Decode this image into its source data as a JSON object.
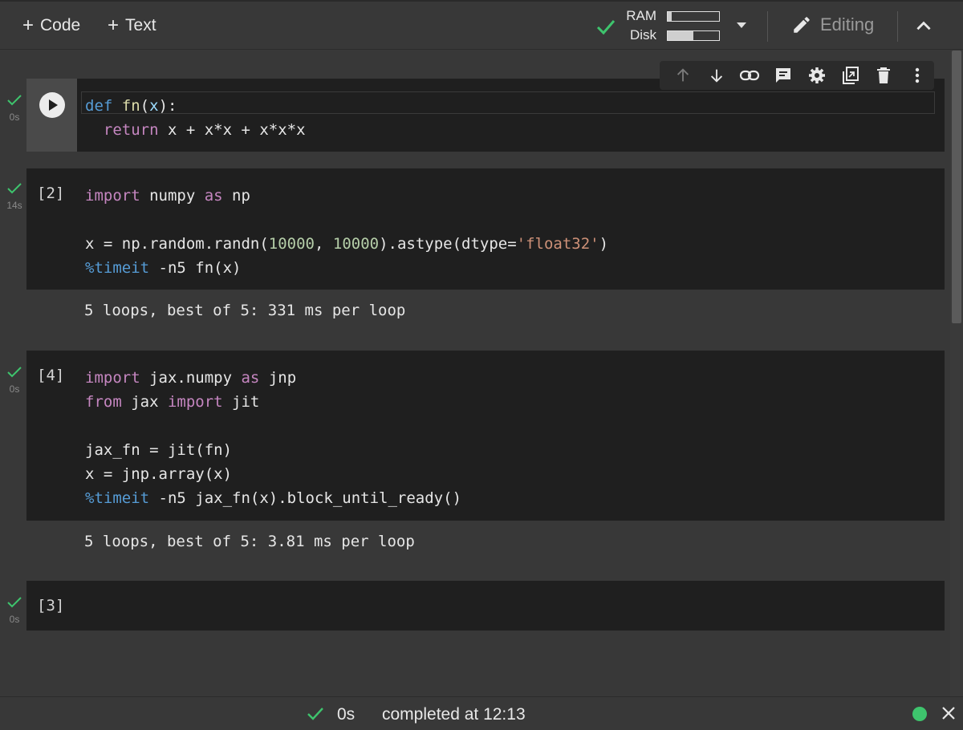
{
  "toolbar": {
    "add_code_label": "Code",
    "add_text_label": "Text",
    "ram_label": "RAM",
    "disk_label": "Disk",
    "ram_usage_fraction": 0.08,
    "disk_usage_fraction": 0.5,
    "editing_label": "Editing"
  },
  "colors": {
    "background": "#383838",
    "cell_background": "#1f1f1f",
    "check_green": "#3ec46d",
    "keyword": "#c586c0",
    "builtin_keyword": "#569cd6",
    "number": "#b5cea8",
    "string": "#ce9178"
  },
  "cells": [
    {
      "exec_count": "",
      "duration": "0s",
      "lines": [
        {
          "tokens": [
            {
              "t": "def",
              "c": "kwb"
            },
            {
              "t": " "
            },
            {
              "t": "fn",
              "c": "fnn"
            },
            {
              "t": "("
            },
            {
              "t": "x",
              "c": "param"
            },
            {
              "t": "):"
            }
          ]
        },
        {
          "tokens": [
            {
              "t": "  "
            },
            {
              "t": "return",
              "c": "kw"
            },
            {
              "t": " x + x*x + x*x*x"
            }
          ]
        }
      ],
      "output": ""
    },
    {
      "exec_count": "[2]",
      "duration": "14s",
      "lines": [
        {
          "tokens": [
            {
              "t": "import",
              "c": "kw"
            },
            {
              "t": " numpy "
            },
            {
              "t": "as",
              "c": "kw"
            },
            {
              "t": " np"
            }
          ]
        },
        {
          "tokens": [
            {
              "t": ""
            }
          ]
        },
        {
          "tokens": [
            {
              "t": "x = np.random.randn("
            },
            {
              "t": "10000",
              "c": "num"
            },
            {
              "t": ", "
            },
            {
              "t": "10000",
              "c": "num"
            },
            {
              "t": ").astype(dtype="
            },
            {
              "t": "'float32'",
              "c": "str"
            },
            {
              "t": ")"
            }
          ]
        },
        {
          "tokens": [
            {
              "t": "%timeit",
              "c": "mag"
            },
            {
              "t": " -n5 fn(x)"
            }
          ]
        }
      ],
      "output": "5 loops, best of 5: 331 ms per loop"
    },
    {
      "exec_count": "[4]",
      "duration": "0s",
      "lines": [
        {
          "tokens": [
            {
              "t": "import",
              "c": "kw"
            },
            {
              "t": " jax.numpy "
            },
            {
              "t": "as",
              "c": "kw"
            },
            {
              "t": " jnp"
            }
          ]
        },
        {
          "tokens": [
            {
              "t": "from",
              "c": "kw"
            },
            {
              "t": " jax "
            },
            {
              "t": "import",
              "c": "kw"
            },
            {
              "t": " jit"
            }
          ]
        },
        {
          "tokens": [
            {
              "t": ""
            }
          ]
        },
        {
          "tokens": [
            {
              "t": "jax_fn = jit(fn)"
            }
          ]
        },
        {
          "tokens": [
            {
              "t": "x = jnp.array(x)"
            }
          ]
        },
        {
          "tokens": [
            {
              "t": "%timeit",
              "c": "mag"
            },
            {
              "t": " -n5 jax_fn(x).block_until_ready()"
            }
          ]
        }
      ],
      "output": "5 loops, best of 5: 3.81 ms per loop"
    },
    {
      "exec_count": "[3]",
      "duration": "0s",
      "lines": [],
      "output": ""
    }
  ],
  "cell_toolbar": [
    "move-up-icon",
    "move-down-icon",
    "link-icon",
    "comment-icon",
    "settings-icon",
    "mirror-cell-icon",
    "delete-icon",
    "more-vert-icon"
  ],
  "statusbar": {
    "duration": "0s",
    "message": "completed at 12:13"
  }
}
